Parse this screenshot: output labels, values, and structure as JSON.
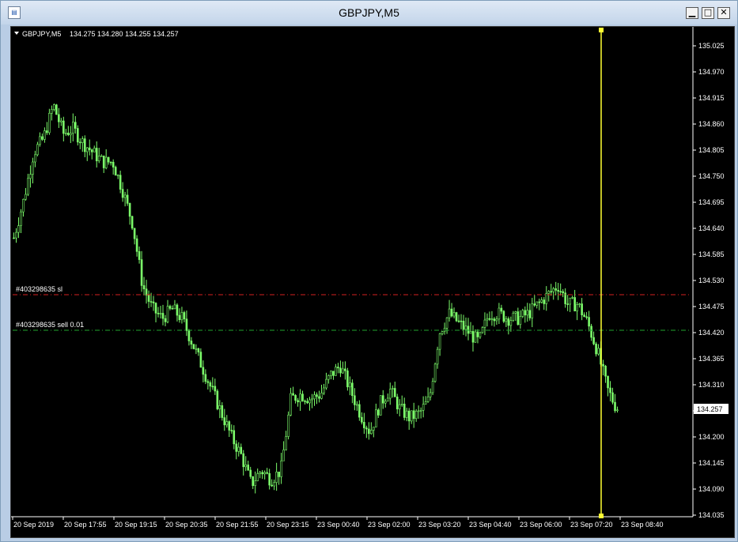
{
  "window": {
    "title": "GBPJPY,M5",
    "minimize_label": "▁",
    "maximize_label": "□",
    "close_label": "✕",
    "icons": [
      "app-icon",
      "minimize-icon",
      "maximize-icon",
      "close-icon"
    ]
  },
  "chart": {
    "header": {
      "symbol": "GBPJPY,M5",
      "ohlc": "134.275 134.280 134.255 134.257"
    },
    "current_price_label": "134.257",
    "lines": [
      {
        "label": "#403298635 sl",
        "price": 134.5,
        "color": "#d42020"
      },
      {
        "label": "#403298635 sell 0.01",
        "price": 134.425,
        "color": "#1fa52e"
      }
    ],
    "colors": {
      "background": "#000000",
      "candles": "#7cfc6a",
      "grid_text": "#ffffff",
      "vline": "#ffff33"
    }
  },
  "chart_data": {
    "type": "candlestick",
    "title": "",
    "xlabel": "",
    "ylabel": "",
    "ylim": [
      134.035,
      135.025
    ],
    "yticks": [
      135.025,
      134.97,
      134.915,
      134.86,
      134.805,
      134.75,
      134.695,
      134.64,
      134.585,
      134.53,
      134.475,
      134.42,
      134.365,
      134.31,
      134.255,
      134.2,
      134.145,
      134.09,
      134.035
    ],
    "xticks": [
      "20 Sep 2019",
      "20 Sep 17:55",
      "20 Sep 19:15",
      "20 Sep 20:35",
      "20 Sep 21:55",
      "20 Sep 23:15",
      "23 Sep 00:40",
      "23 Sep 02:00",
      "23 Sep 03:20",
      "23 Sep 04:40",
      "23 Sep 06:00",
      "23 Sep 07:20",
      "23 Sep 08:40"
    ],
    "close_path": [
      134.62,
      134.7,
      134.8,
      134.83,
      134.9,
      134.84,
      134.85,
      134.82,
      134.8,
      134.78,
      134.78,
      134.72,
      134.65,
      134.52,
      134.47,
      134.45,
      134.47,
      134.45,
      134.4,
      134.35,
      134.3,
      134.25,
      134.2,
      134.16,
      134.1,
      134.13,
      134.11,
      134.13,
      134.28,
      134.29,
      134.28,
      134.29,
      134.33,
      134.35,
      134.3,
      134.25,
      134.21,
      134.27,
      134.3,
      134.26,
      134.24,
      134.25,
      134.28,
      134.42,
      134.46,
      134.44,
      134.42,
      134.4,
      134.46,
      134.46,
      134.45,
      134.45,
      134.46,
      134.48,
      134.5,
      134.52,
      134.48,
      134.48,
      134.44,
      134.38,
      134.3,
      134.257
    ],
    "series": [
      {
        "name": "GBPJPY,M5",
        "last_close": 134.257
      }
    ]
  }
}
